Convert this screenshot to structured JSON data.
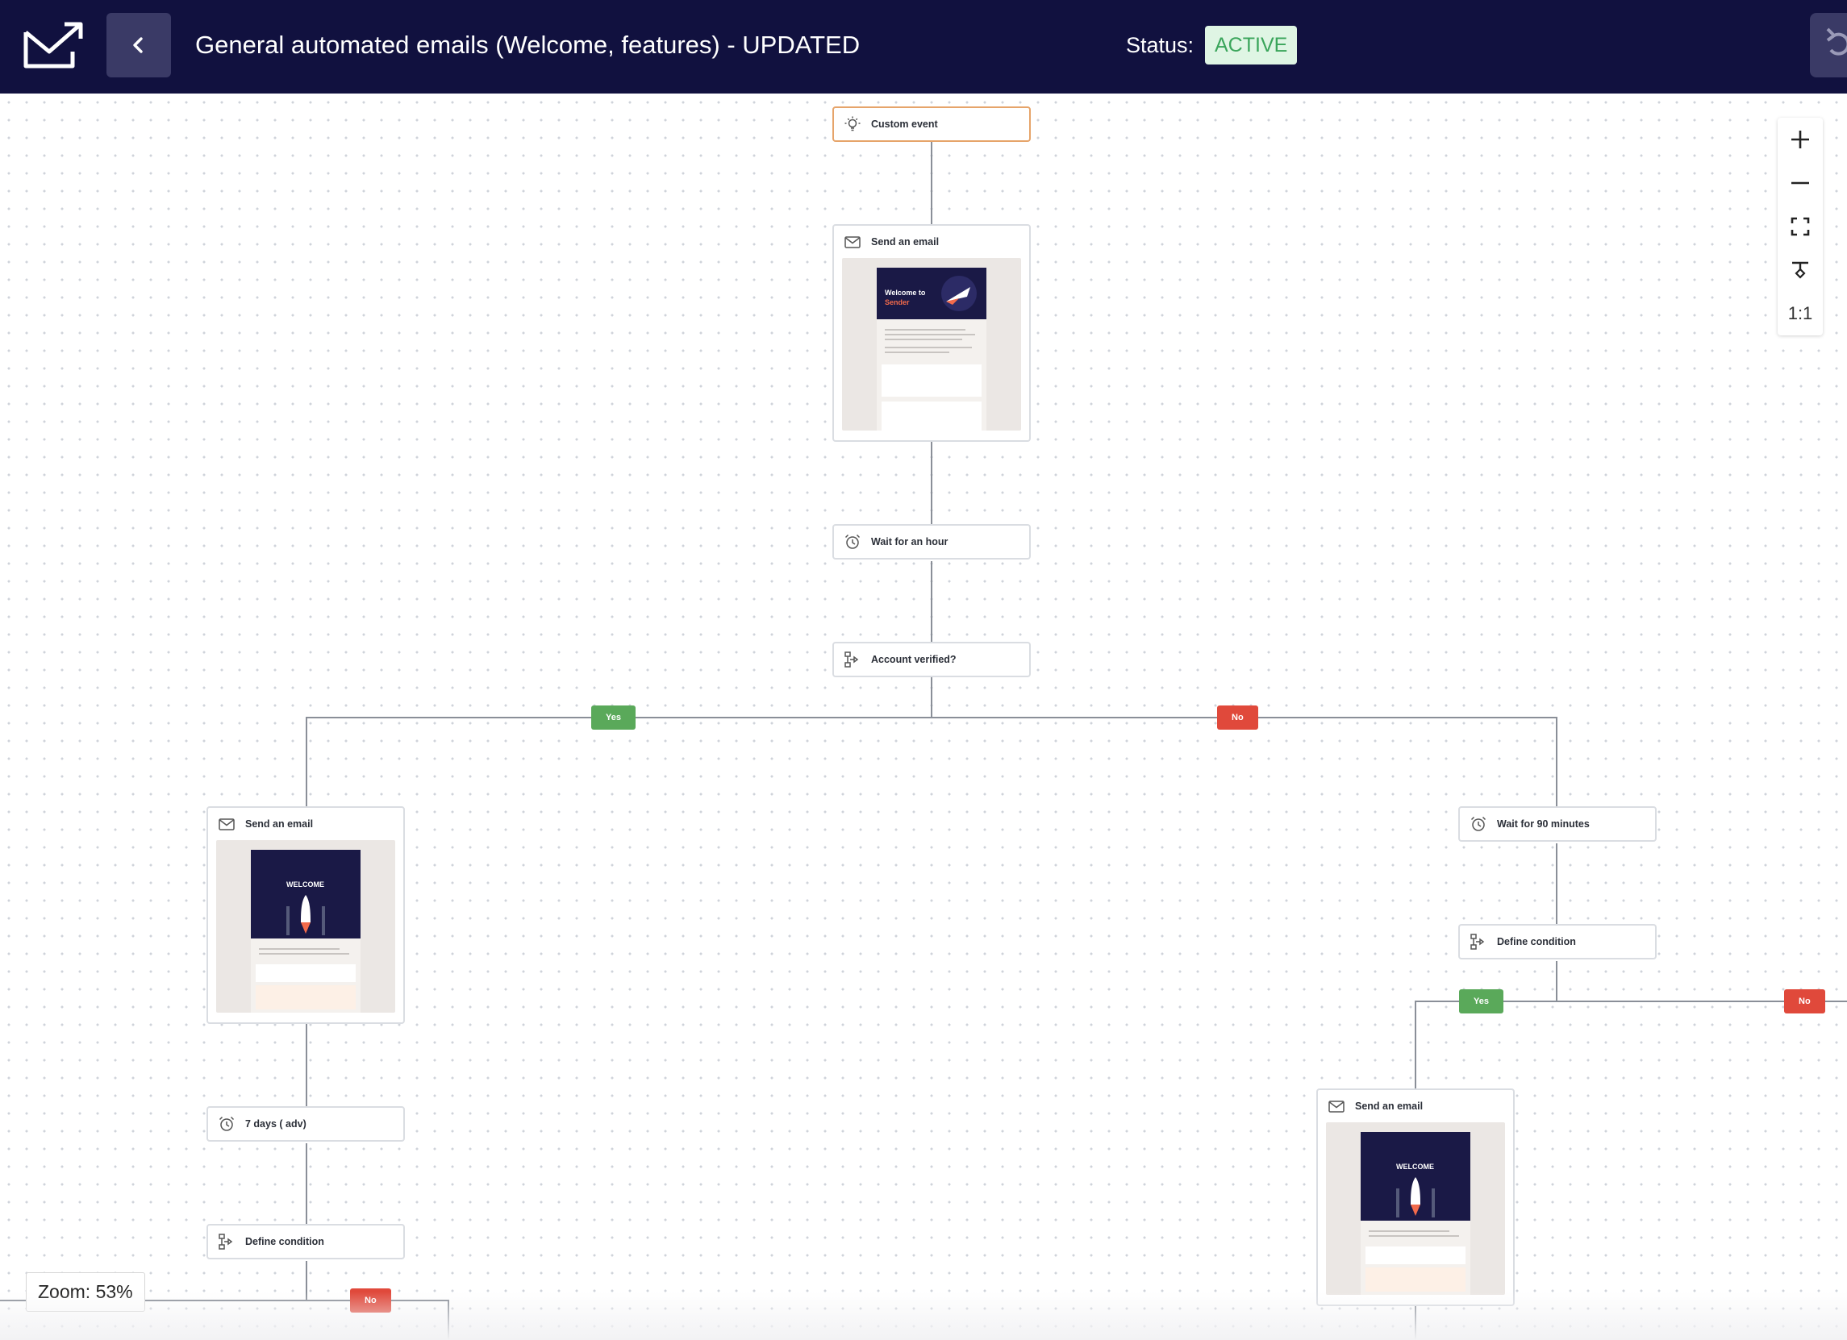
{
  "header": {
    "title": "General automated emails (Welcome, features) - UPDATED",
    "status_label": "Status:",
    "status_value": "ACTIVE"
  },
  "nodes": {
    "custom_event": "Custom event",
    "send_email_1": "Send an email",
    "wait_hour": "Wait for an hour",
    "account_verified": "Account verified?",
    "send_email_2": "Send an email",
    "wait_90": "Wait for 90 minutes",
    "define_condition_1": "Define condition",
    "send_email_3": "Send an email",
    "days_7": "7 days ( adv)",
    "define_condition_2": "Define condition"
  },
  "previews": {
    "email_1_heading_line1": "Welcome to",
    "email_1_heading_line2": "Sender",
    "email_2_heading": "WELCOME",
    "email_3_heading": "WELCOME"
  },
  "branches": {
    "yes": "Yes",
    "no": "No"
  },
  "zoom_controls": {
    "one_to_one": "1:1"
  },
  "zoom": {
    "label": "Zoom: 53%"
  },
  "colors": {
    "header_bg": "#11113f",
    "status_bg": "#dff5e4",
    "status_text": "#3aa55b",
    "yes": "#5aa95a",
    "no": "#e0493b",
    "trigger_border": "#e6a46a"
  },
  "icons": [
    "envelope-logo-icon",
    "chevron-left-icon",
    "lightbulb-icon",
    "envelope-icon",
    "alarm-clock-icon",
    "condition-icon",
    "plus-icon",
    "minus-icon",
    "fit-screen-icon",
    "auto-layout-icon"
  ]
}
